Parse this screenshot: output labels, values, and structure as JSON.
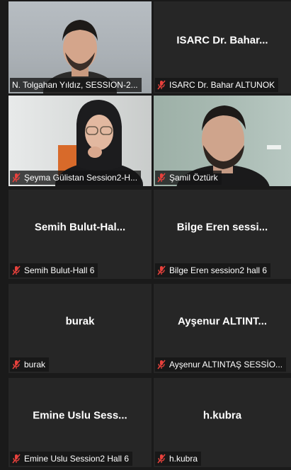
{
  "participants": [
    {
      "display_name": "N. Tolgahan Yıldız, SESSION-2...",
      "center_name": "",
      "has_video": true,
      "muted": false,
      "speaking": true
    },
    {
      "display_name": "ISARC Dr. Bahar ALTUNOK",
      "center_name": "ISARC Dr. Bahar...",
      "has_video": false,
      "muted": true,
      "speaking": false
    },
    {
      "display_name": "Şeyma Gülistan Session2-H...",
      "center_name": "",
      "has_video": true,
      "muted": true,
      "speaking": false
    },
    {
      "display_name": "Şamil Öztürk",
      "center_name": "",
      "has_video": true,
      "muted": true,
      "speaking": false
    },
    {
      "display_name": "Semih Bulut-Hall 6",
      "center_name": "Semih  Bulut-Hal...",
      "has_video": false,
      "muted": true,
      "speaking": false
    },
    {
      "display_name": "Bilge Eren session2 hall 6",
      "center_name": "Bilge Eren sessi...",
      "has_video": false,
      "muted": true,
      "speaking": false
    },
    {
      "display_name": "burak",
      "center_name": "burak",
      "has_video": false,
      "muted": true,
      "speaking": false
    },
    {
      "display_name": "Ayşenur ALTINTAŞ SESSİO...",
      "center_name": "Ayşenur ALTINT...",
      "has_video": false,
      "muted": true,
      "speaking": false
    },
    {
      "display_name": "Emine Uslu Session2 Hall 6",
      "center_name": "Emine Uslu Sess...",
      "has_video": false,
      "muted": true,
      "speaking": false
    },
    {
      "display_name": "h.kubra",
      "center_name": "h.kubra",
      "has_video": false,
      "muted": true,
      "speaking": false
    }
  ],
  "icons": {
    "muted": "muted-mic-icon"
  },
  "colors": {
    "active_speaker_border": "#c7e23b",
    "muted_icon": "#e8413c",
    "tile_bg": "#262626",
    "page_bg": "#1a1a1a"
  }
}
